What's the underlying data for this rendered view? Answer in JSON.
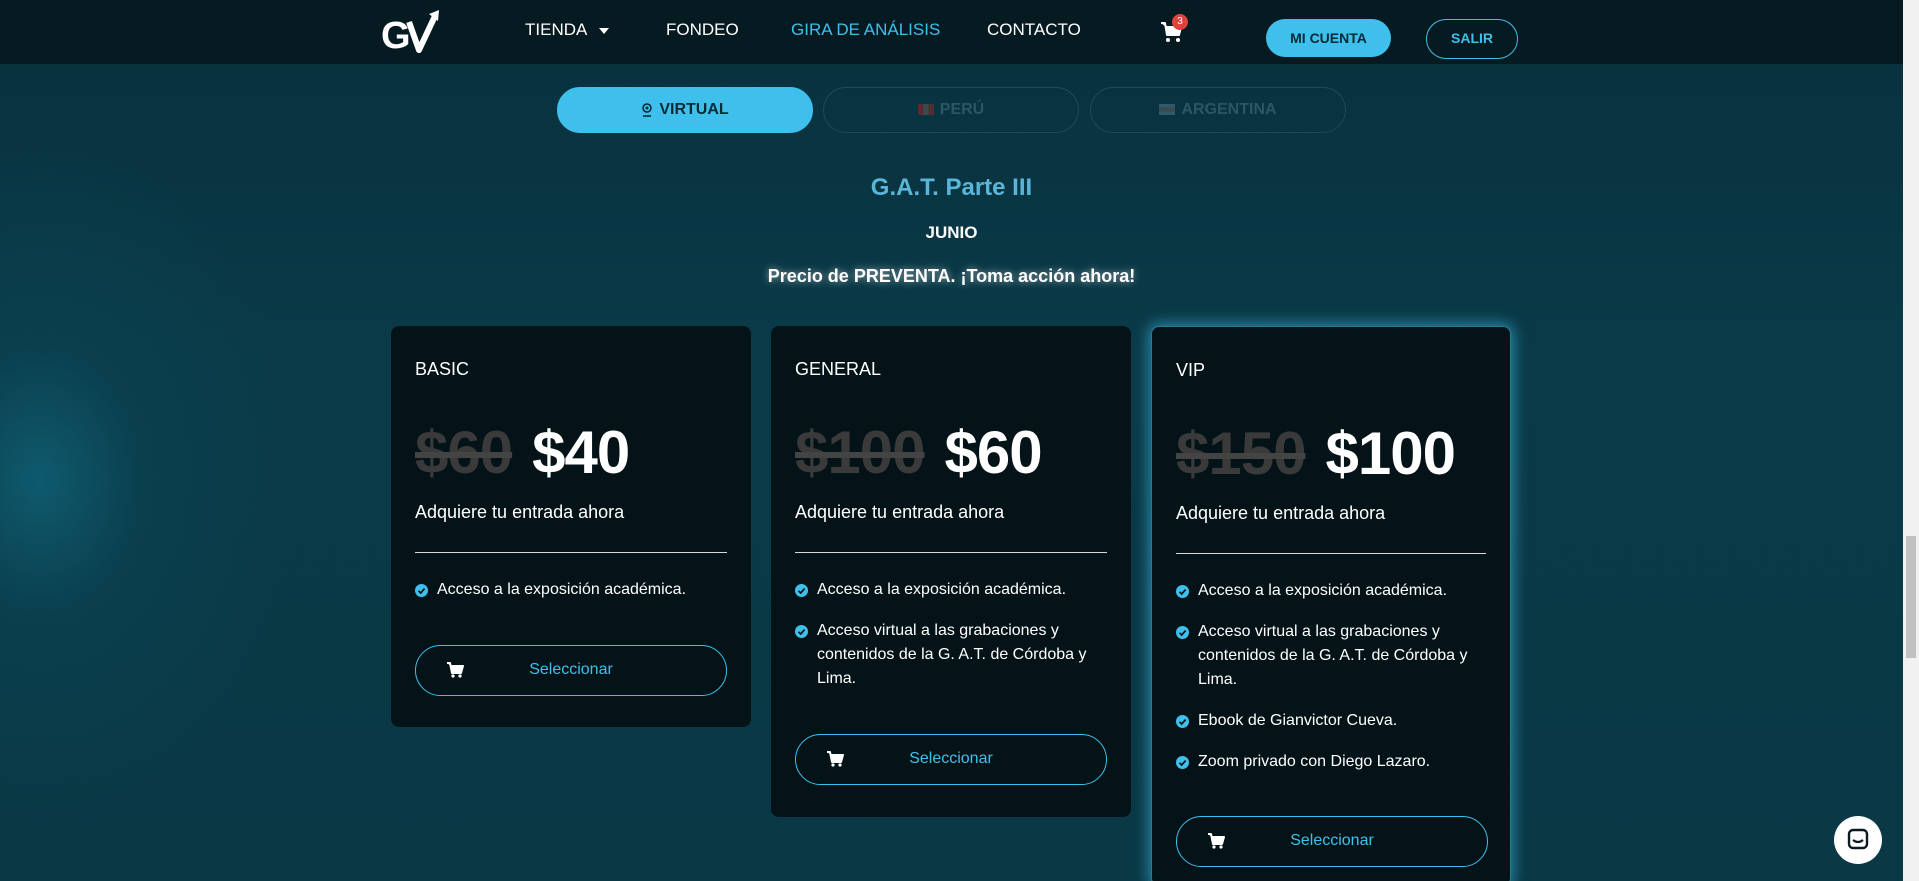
{
  "header": {
    "nav": {
      "tienda": "TIENDA",
      "fondeo": "FONDEO",
      "gira": "GIRA DE ANÁLISIS",
      "contacto": "CONTACTO"
    },
    "cart_count": "3",
    "account_label": "MI CUENTA",
    "logout_label": "SALIR"
  },
  "tabs": [
    {
      "label": "VIRTUAL",
      "active": true
    },
    {
      "label": "PERÚ",
      "active": false
    },
    {
      "label": "ARGENTINA",
      "active": false
    }
  ],
  "event": {
    "title": "G.A.T. Parte III",
    "month": "JUNIO",
    "presale": "Precio de PREVENTA. ¡Toma acción ahora!"
  },
  "plans": [
    {
      "name": "BASIC",
      "old_price": "$60",
      "price": "$40",
      "subtitle": "Adquiere tu entrada ahora",
      "features": [
        "Acceso a la exposición académica."
      ],
      "button": "Seleccionar"
    },
    {
      "name": "GENERAL",
      "old_price": "$100",
      "price": "$60",
      "subtitle": "Adquiere tu entrada ahora",
      "features": [
        "Acceso a la exposición académica.",
        "Acceso virtual a las grabaciones y contenidos de la G. A.T. de Córdoba y Lima."
      ],
      "button": "Seleccionar"
    },
    {
      "name": "VIP",
      "old_price": "$150",
      "price": "$100",
      "subtitle": "Adquiere tu entrada ahora",
      "features": [
        "Acceso a la exposición académica.",
        "Acceso virtual a las grabaciones y contenidos de la G. A.T. de Córdoba y Lima.",
        "Ebook de Gianvictor Cueva.",
        "Zoom privado con Diego Lazaro."
      ],
      "button": "Seleccionar"
    }
  ],
  "colors": {
    "accent": "#3fc0ec",
    "background": "#0a3845",
    "card": "#041318",
    "badge": "#e0433c"
  }
}
